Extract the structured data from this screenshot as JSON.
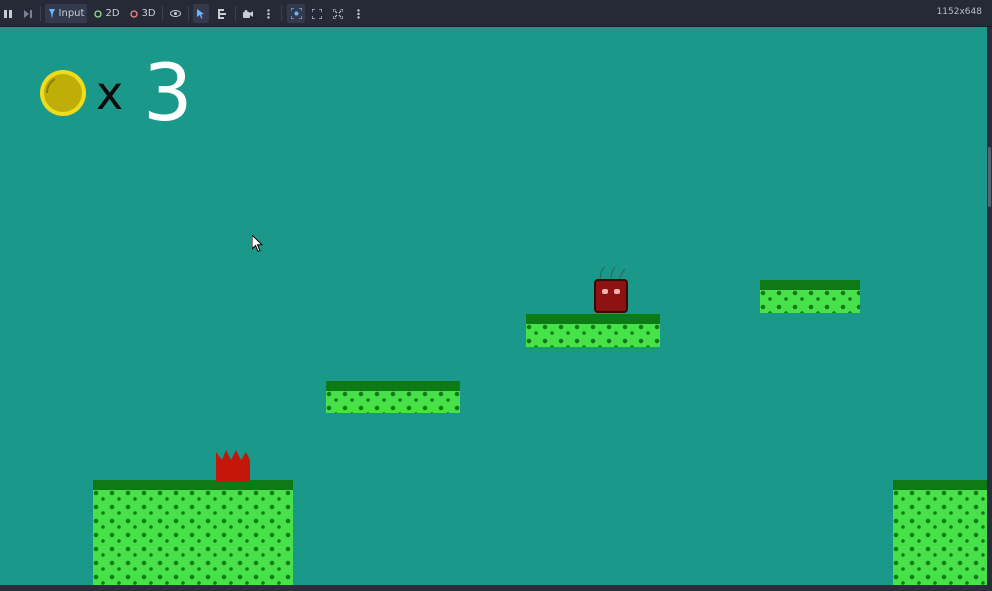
{
  "toolbar": {
    "input_label": "Input",
    "mode_2d_label": "2D",
    "mode_3d_label": "3D",
    "resolution": "1152x648",
    "icons": [
      "pause-icon",
      "step-icon",
      "input-icon",
      "eye-icon",
      "select-arrow-icon",
      "list-icon",
      "camera-icon",
      "more-icon",
      "focus-icon",
      "expand-icon",
      "fullscreen-icon",
      "more-icon"
    ]
  },
  "hud": {
    "times_symbol": "x",
    "coin_count": "3",
    "coin_color": "#bfae07"
  },
  "colors": {
    "sky": "#1a998b",
    "grass": "#0e7a16",
    "soil": "#47e24a",
    "player": "#8e1212",
    "spikes": "#c4170c"
  }
}
